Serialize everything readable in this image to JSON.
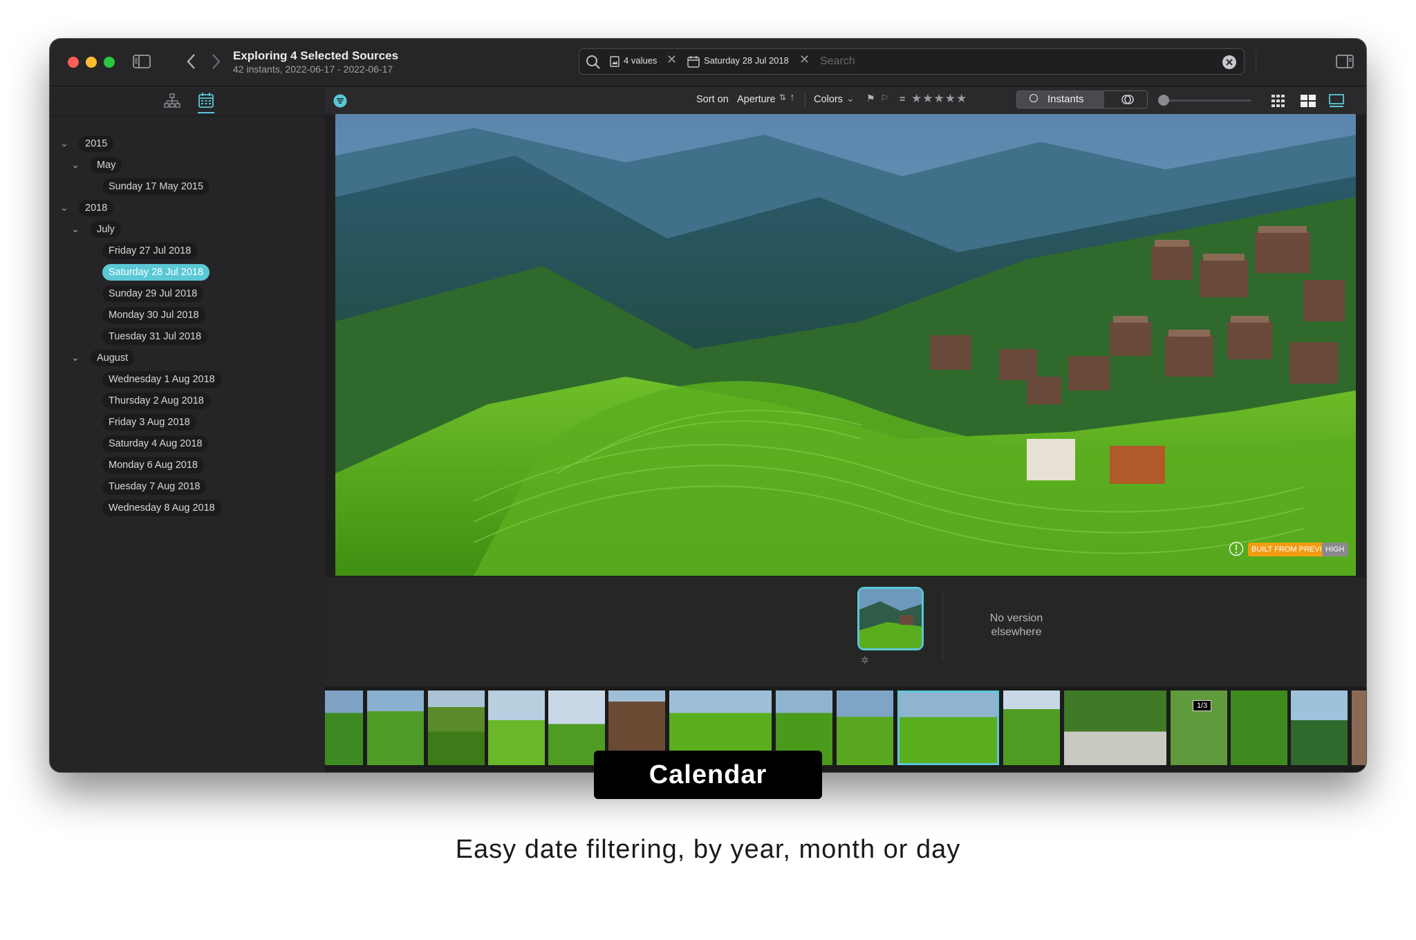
{
  "window": {
    "title": "Exploring 4 Selected Sources",
    "subtitle": "42 instants, 2022-06-17 - 2022-06-17"
  },
  "search": {
    "chip1_label": "4 values",
    "chip2_label": "Saturday 28 Jul 2018",
    "placeholder": "Search"
  },
  "sidebar": {
    "tree": [
      {
        "kind": "year",
        "label": "2015"
      },
      {
        "kind": "month",
        "label": "May"
      },
      {
        "kind": "day",
        "label": "Sunday 17 May 2015"
      },
      {
        "kind": "year",
        "label": "2018"
      },
      {
        "kind": "month",
        "label": "July"
      },
      {
        "kind": "day",
        "label": "Friday 27 Jul 2018"
      },
      {
        "kind": "day",
        "label": "Saturday 28 Jul 2018",
        "selected": true
      },
      {
        "kind": "day",
        "label": "Sunday 29 Jul 2018"
      },
      {
        "kind": "day",
        "label": "Monday 30 Jul 2018"
      },
      {
        "kind": "day",
        "label": "Tuesday 31 Jul 2018"
      },
      {
        "kind": "month",
        "label": "August"
      },
      {
        "kind": "day",
        "label": "Wednesday 1 Aug 2018"
      },
      {
        "kind": "day",
        "label": "Thursday 2 Aug 2018"
      },
      {
        "kind": "day",
        "label": "Friday 3 Aug 2018"
      },
      {
        "kind": "day",
        "label": "Saturday 4 Aug 2018"
      },
      {
        "kind": "day",
        "label": "Monday 6 Aug 2018"
      },
      {
        "kind": "day",
        "label": "Tuesday 7 Aug 2018"
      },
      {
        "kind": "day",
        "label": "Wednesday 8 Aug 2018"
      }
    ]
  },
  "toolbar": {
    "sort_prefix": "Sort on",
    "sort_value": "Aperture",
    "colors_label": "Colors",
    "equals_label": "=",
    "instants_label": "Instants"
  },
  "viewer": {
    "badge_preview": "BUILT FROM PREVIEW",
    "badge_quality": "HIGH",
    "no_version_text": "No version elsewhere"
  },
  "filmstrip": {
    "stack_badge": "1/3"
  },
  "promo": {
    "label": "Calendar",
    "caption": "Easy date filtering, by year, month or day"
  },
  "colors": {
    "accent": "#5bc8d6",
    "badge_orange": "#f39c12",
    "badge_gray": "#8a8a8e"
  }
}
